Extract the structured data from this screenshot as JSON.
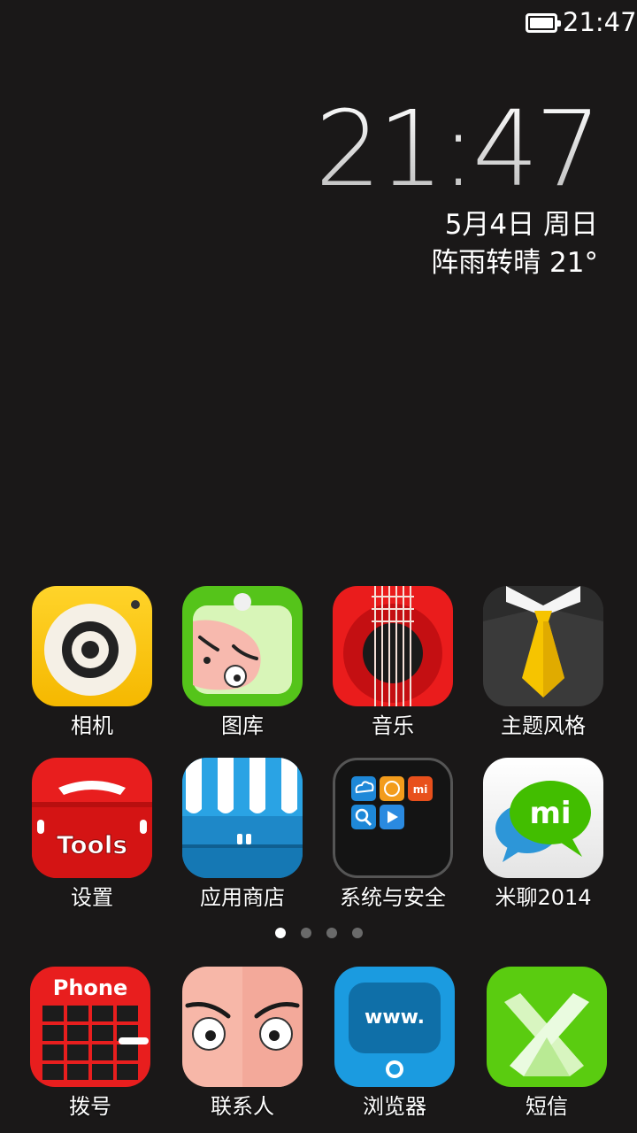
{
  "status_bar": {
    "time": "21:47",
    "battery_icon": "battery-full-icon",
    "battery_level": 1.0
  },
  "clock_widget": {
    "time": "21:47",
    "date": "5月4日  周日",
    "weather": "阵雨转晴   21°"
  },
  "apps": [
    {
      "label": "相机",
      "icon": "camera-icon"
    },
    {
      "label": "图库",
      "icon": "gallery-icon"
    },
    {
      "label": "音乐",
      "icon": "music-icon"
    },
    {
      "label": "主题风格",
      "icon": "theme-icon"
    },
    {
      "label": "设置",
      "icon": "tools-icon",
      "icon_text": "Tools"
    },
    {
      "label": "应用商店",
      "icon": "store-icon"
    },
    {
      "label": "系统与安全",
      "icon": "folder-icon",
      "icon_text": "mi"
    },
    {
      "label": "米聊2014",
      "icon": "miliao-icon",
      "icon_text": "mi"
    }
  ],
  "page_indicator": {
    "pages": 4,
    "current": 1
  },
  "dock": [
    {
      "label": "拨号",
      "icon": "phone-icon",
      "icon_text": "Phone"
    },
    {
      "label": "联系人",
      "icon": "contacts-icon"
    },
    {
      "label": "浏览器",
      "icon": "browser-icon",
      "icon_text": "www."
    },
    {
      "label": "短信",
      "icon": "messages-icon"
    }
  ],
  "colors": {
    "background": "#1a1818",
    "camera": "#f8c400",
    "gallery": "#57c51c",
    "music": "#ea1c1c",
    "theme": "#3b3b3b",
    "tools": "#e81e1e",
    "store": "#1e88c8",
    "miliao": "#3fb800",
    "phone": "#e81e1e",
    "contacts": "#f7b7a8",
    "browser": "#1b9be0",
    "messages": "#5acc10"
  }
}
